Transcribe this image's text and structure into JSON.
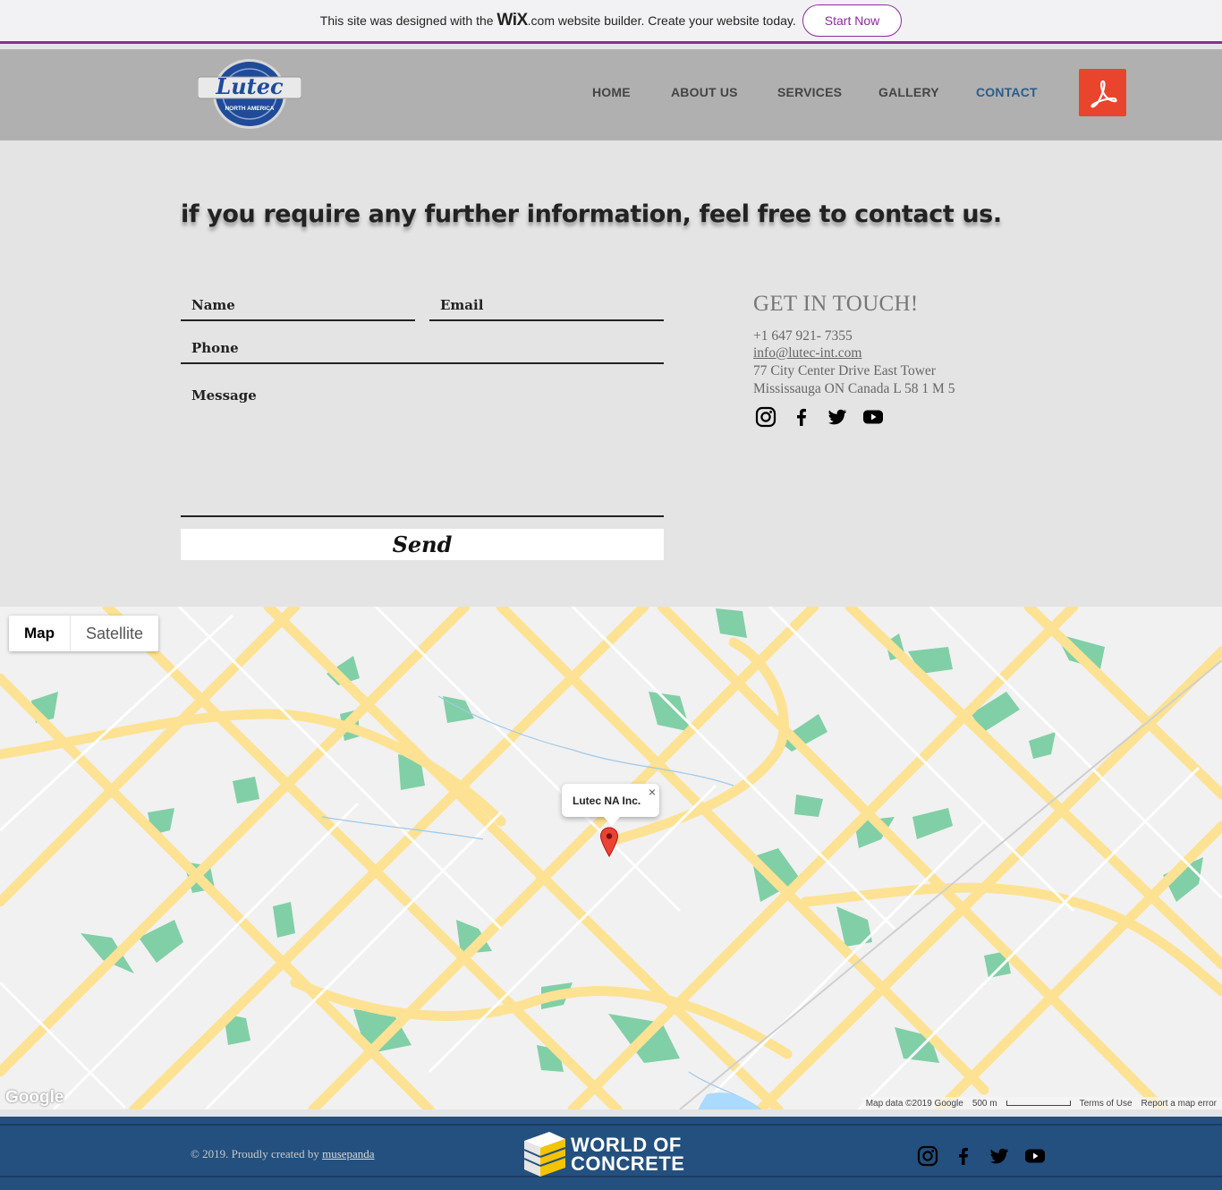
{
  "wix_banner": {
    "text_before": "This site was designed with the ",
    "logo_wix": "WiX",
    "logo_com": ".com",
    "text_after": " website builder. Create your website today.",
    "button": "Start Now"
  },
  "header": {
    "logo_main": "Lutec",
    "logo_sub": "NORTH AMERICA",
    "nav": [
      "HOME",
      "ABOUT US",
      "SERVICES",
      "GALLERY",
      "CONTACT"
    ],
    "active_nav": "CONTACT",
    "pdf_icon": "adobe-pdf-icon"
  },
  "main": {
    "headline": "if you require any further information, feel free to contact us.",
    "form": {
      "name_label": "Name",
      "email_label": "Email",
      "phone_label": "Phone",
      "message_label": "Message",
      "send_label": "Send"
    },
    "contact": {
      "title": "GET IN TOUCH!",
      "phone": "+1 647 921- 7355",
      "email": "info@lutec-int.com",
      "address_line1": "77 City Center Drive East Tower",
      "address_line2": "Mississauga ON Canada L 58 1 M 5"
    },
    "social_icons": [
      "instagram-icon",
      "facebook-icon",
      "twitter-icon",
      "youtube-icon"
    ]
  },
  "map": {
    "toggle_map": "Map",
    "toggle_satellite": "Satellite",
    "marker_label": "Lutec NA Inc.",
    "close_glyph": "×",
    "google_logo": "Google",
    "map_data": "Map data ©2019 Google",
    "scale": "500 m",
    "terms": "Terms of Use",
    "report": "Report a map error",
    "colors": {
      "road": "#fde293",
      "park": "#81cfa6",
      "background": "#f1f1f1"
    }
  },
  "footer": {
    "copyright_prefix": "© 2019. Proudly created by ",
    "copyright_brand": "musepanda",
    "logo_line1": "WORLD OF",
    "logo_line2": "CONCRETE",
    "social_icons": [
      "instagram-icon",
      "facebook-icon",
      "twitter-icon",
      "youtube-icon"
    ]
  }
}
